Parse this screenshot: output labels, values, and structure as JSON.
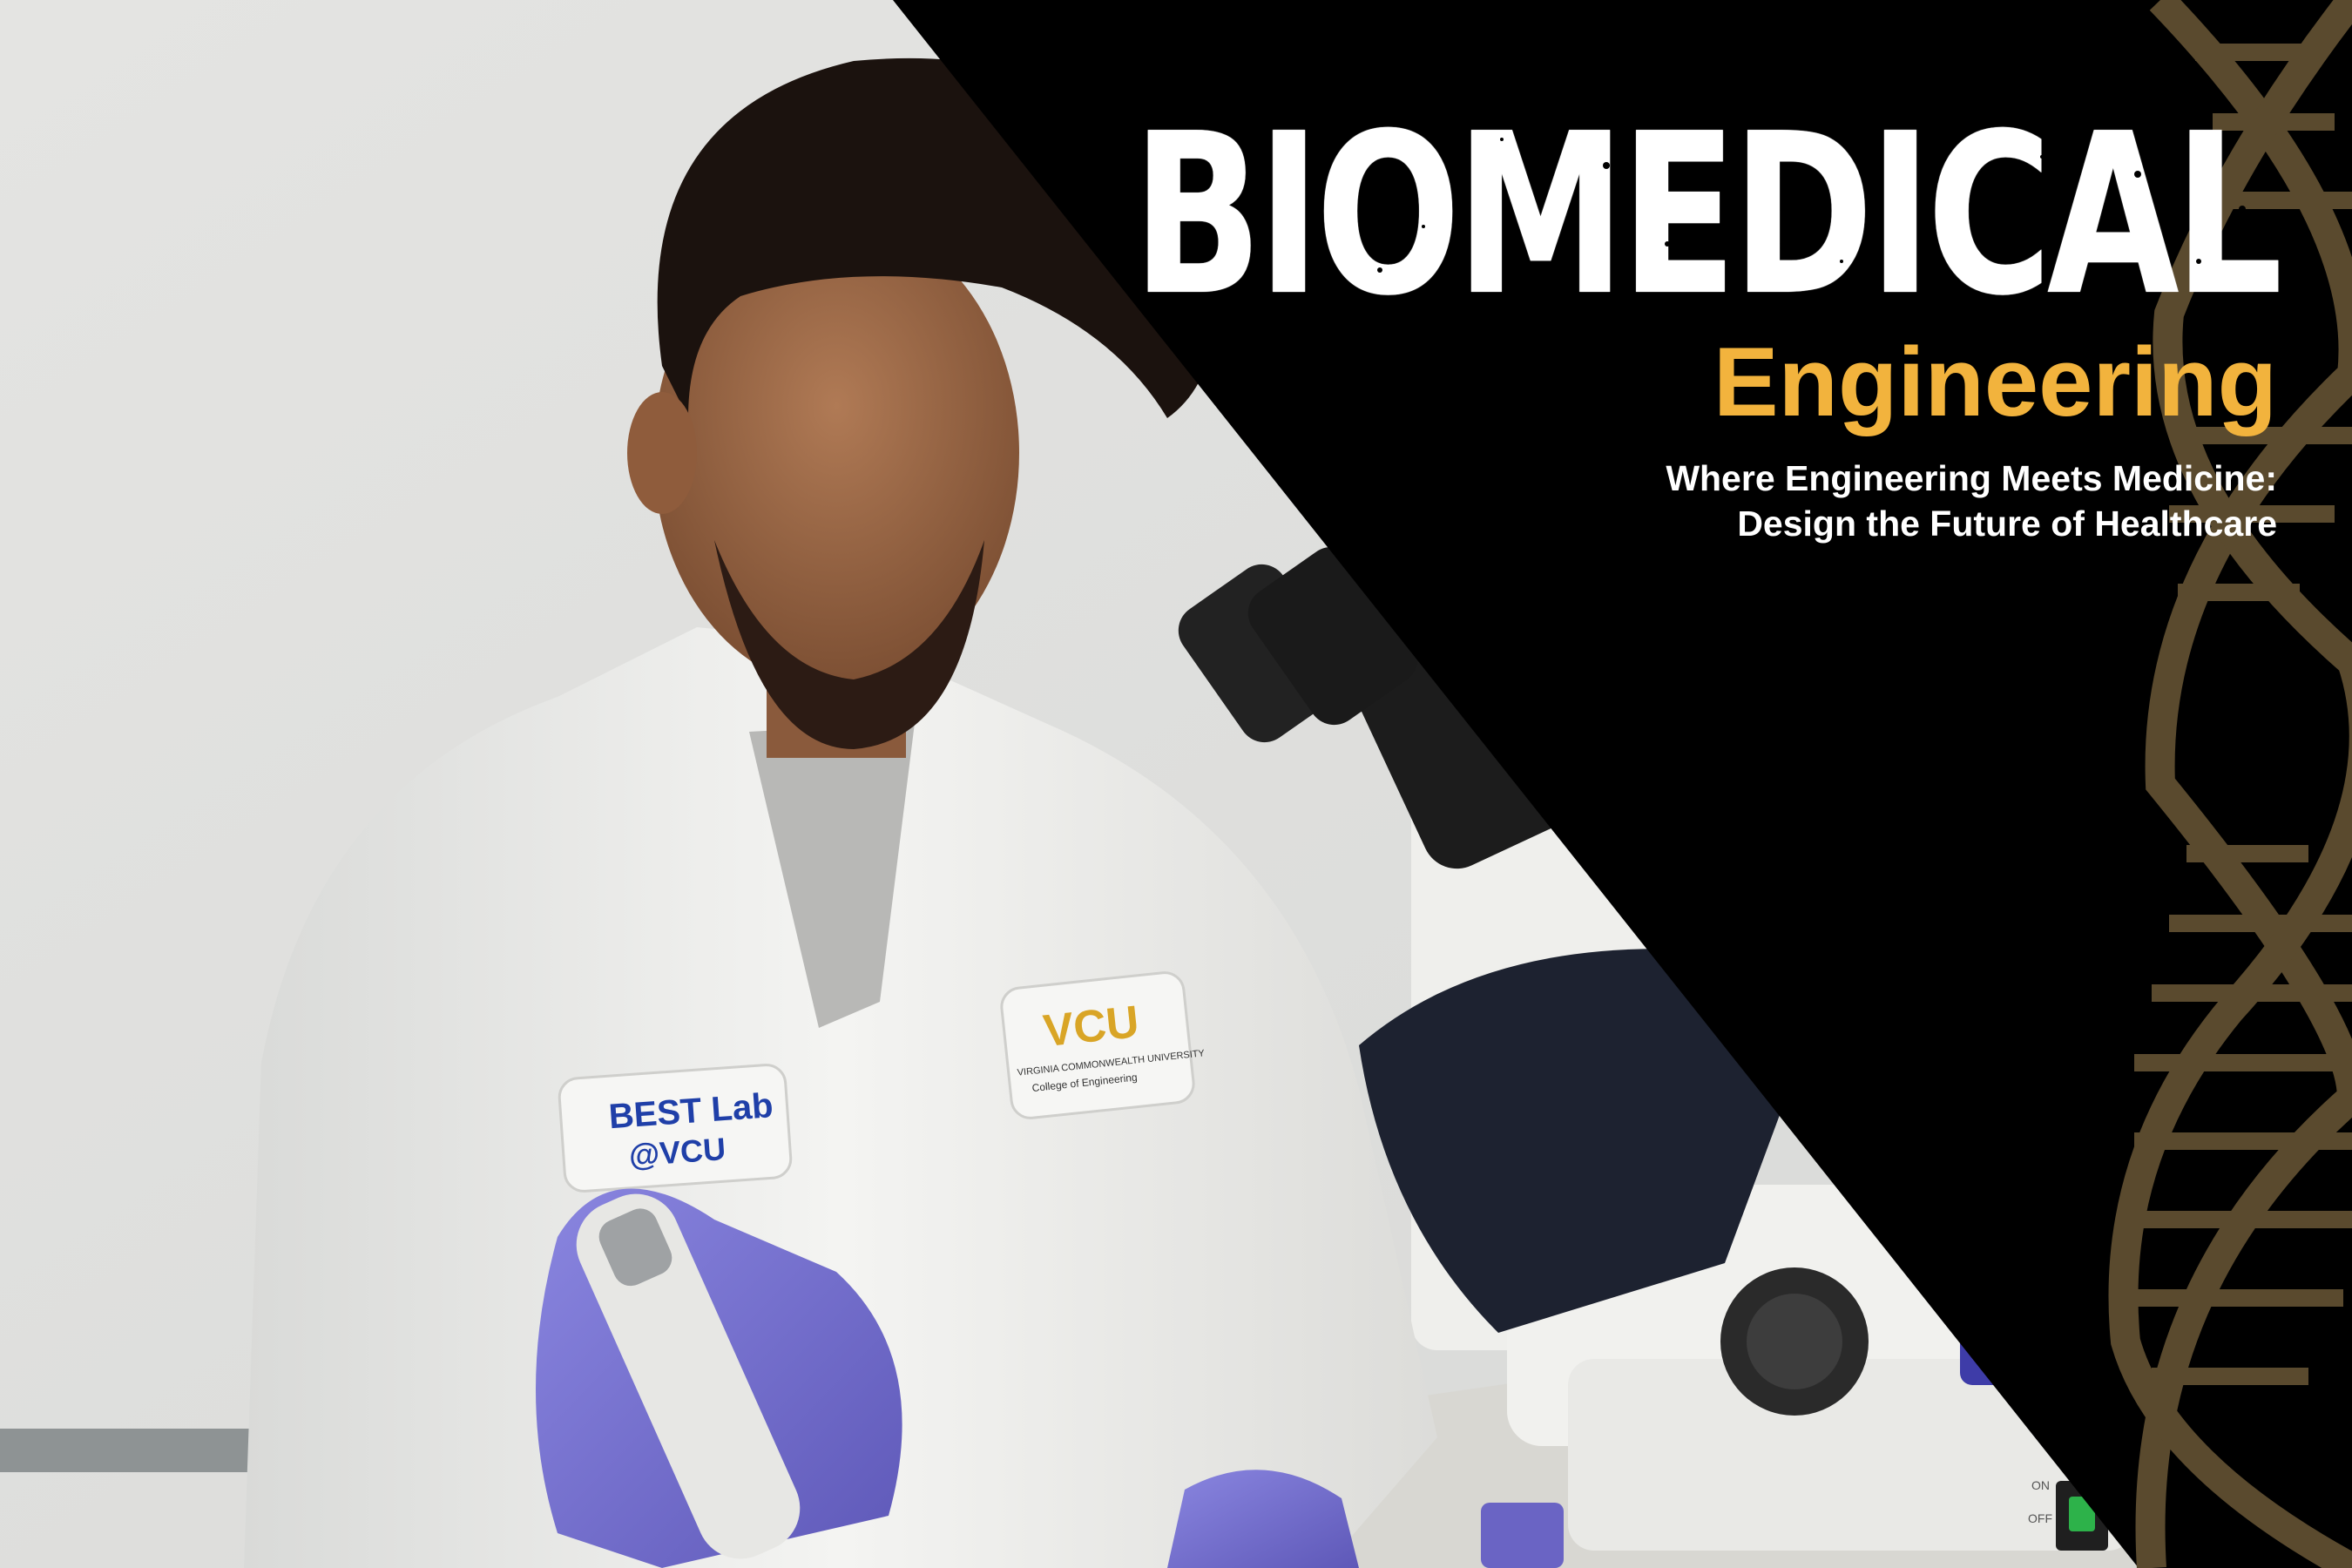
{
  "header": {
    "title": "BIOMEDICAL",
    "subtitle": "Engineering",
    "tagline_line1": "Where Engineering Meets Medicine:",
    "tagline_line2": "Design the Future of Healthcare"
  },
  "patches": {
    "lab_patch_line1": "BEST Lab",
    "lab_patch_line2": "@VCU",
    "vcu_logo": "VCU",
    "vcu_university": "VIRGINIA COMMONWEALTH UNIVERSITY",
    "vcu_college": "College of Engineering"
  },
  "microscope": {
    "switch_on": "ON",
    "switch_off": "OFF"
  },
  "colors": {
    "accent_gold": "#f2b33d",
    "panel_black": "#000000",
    "dna_bronze": "#5a4a2e",
    "glove_purple": "#7f7ad6"
  }
}
